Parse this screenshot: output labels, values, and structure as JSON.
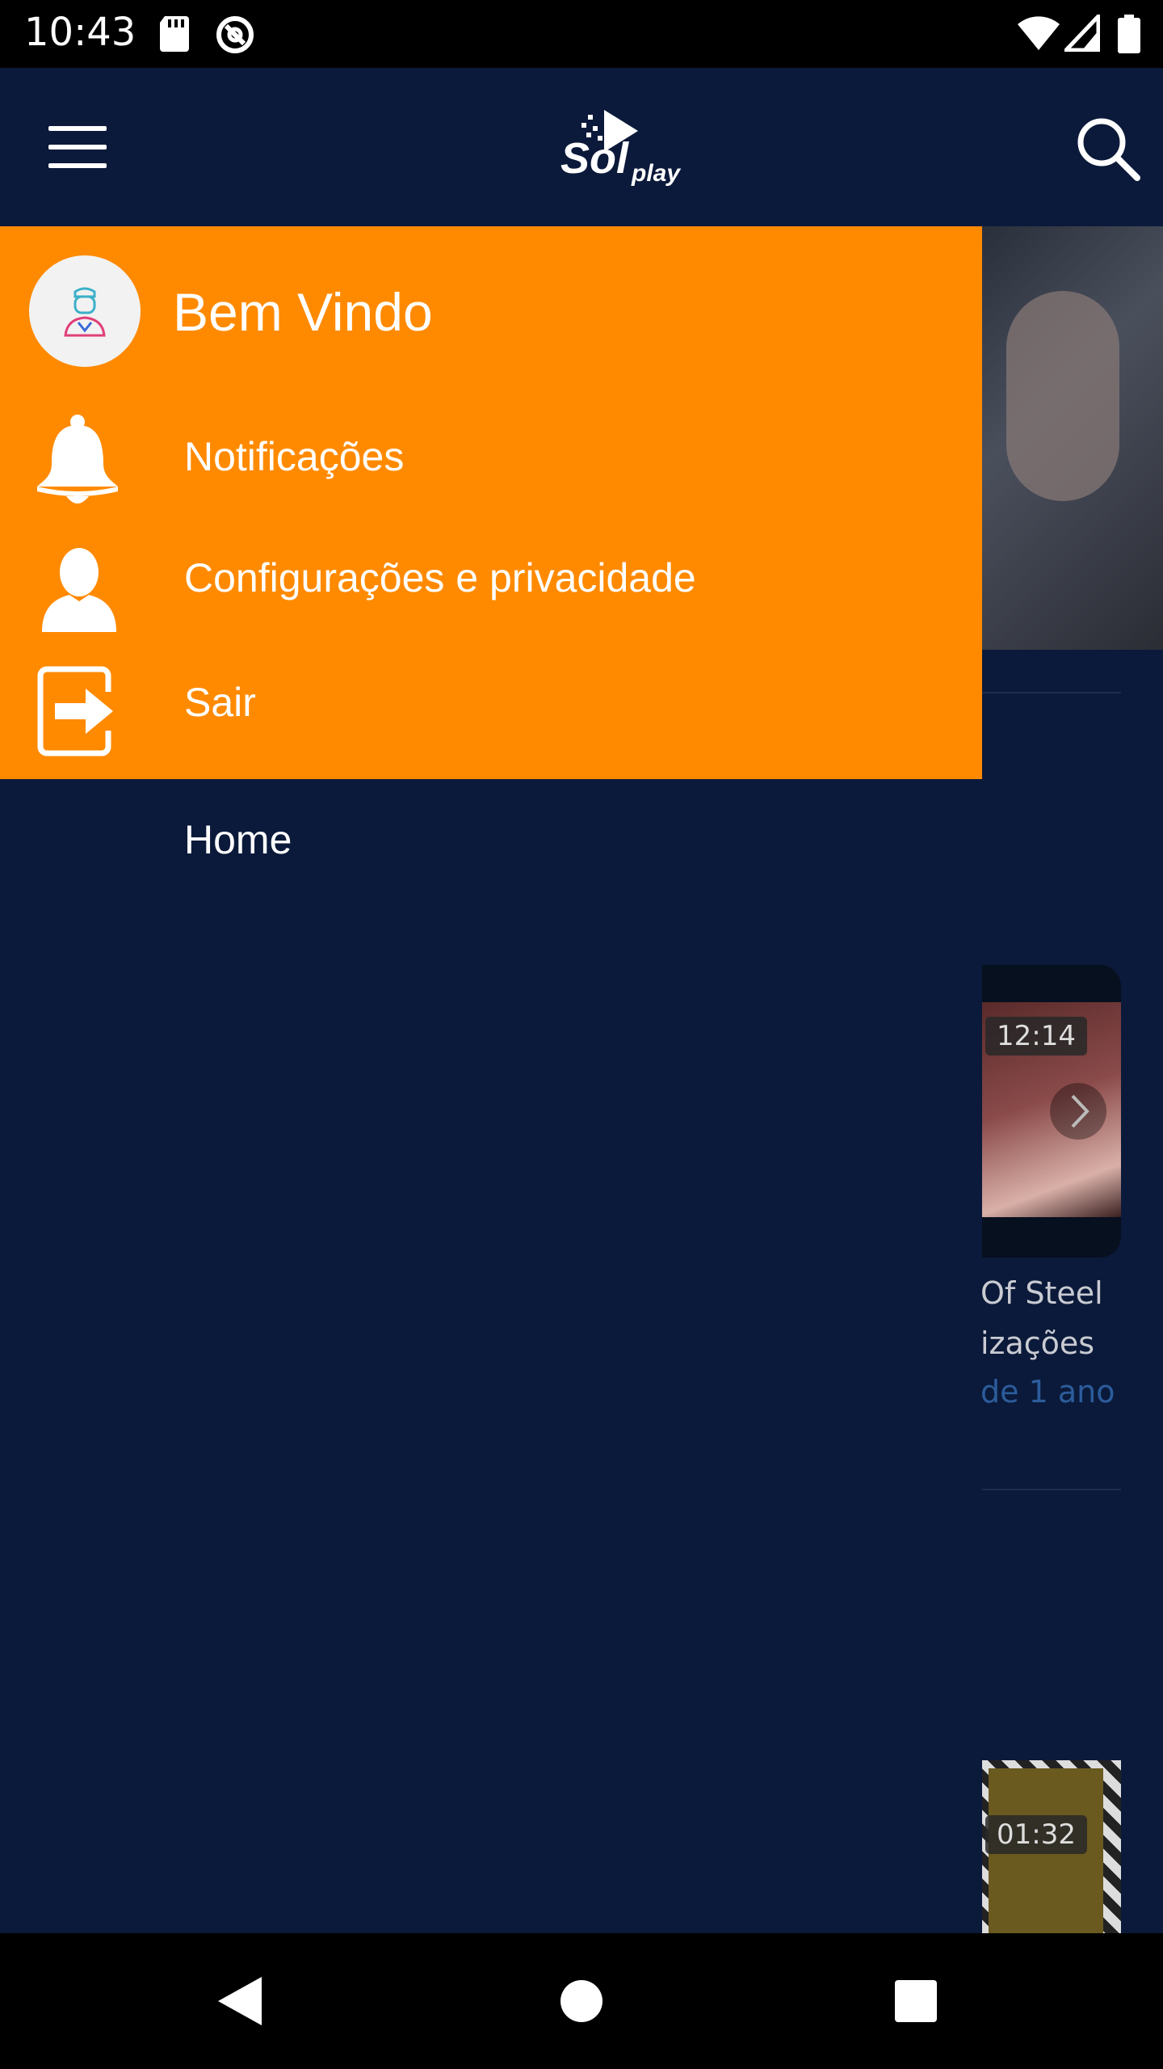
{
  "status_bar": {
    "time": "10:43",
    "icons": [
      "sd-card-icon",
      "sync-icon",
      "wifi-icon",
      "signal-icon",
      "battery-icon"
    ]
  },
  "app_bar": {
    "menu_icon": "hamburger-menu-icon",
    "logo": "Solplay",
    "search_icon": "search-icon"
  },
  "drawer": {
    "header_color": "#ff8a00",
    "background_color": "#0b1a3a",
    "welcome": "Bem Vindo",
    "items": [
      {
        "label": "Notificações",
        "icon": "bell-icon"
      },
      {
        "label": "Configurações e privacidade",
        "icon": "user-icon"
      },
      {
        "label": "Sair",
        "icon": "logout-icon"
      }
    ],
    "nav": [
      {
        "label": "Home"
      }
    ]
  },
  "background_content": {
    "video1": {
      "duration": "12:14",
      "title_line1": "Of Steel",
      "title_line2": "izações",
      "meta": "de 1 ano"
    },
    "video2": {
      "duration": "01:32"
    }
  },
  "nav_bar": {
    "back": "back-triangle-icon",
    "home": "home-circle-icon",
    "recents": "recents-square-icon"
  }
}
